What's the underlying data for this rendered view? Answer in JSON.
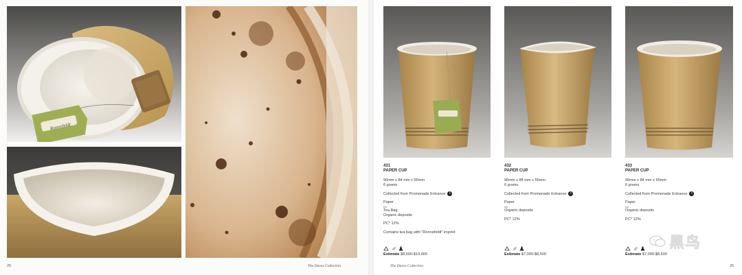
{
  "spread": {
    "left_folio": "25",
    "right_folio": "26",
    "collection_left": "The Davos Collection",
    "collection_right": "The Davos Collection"
  },
  "left_page": {
    "photos": [
      {
        "subject": "paper cup on its side with tea bag"
      },
      {
        "subject": "close-up of cup rim"
      },
      {
        "subject": "close-up of stained cup bottom"
      }
    ],
    "tag_text": "Ronnefeldt"
  },
  "lots": [
    {
      "number": "431",
      "title": "PAPER CUP",
      "dimensions": "90mm x 84 mm x 55mm",
      "weight": "6 grams",
      "collected": "Collected from Promenade Entrance",
      "info_marker": "i",
      "materials": [
        "Paper",
        "Tea Bag",
        "Organic deposits"
      ],
      "material_sub": "Ink",
      "pc": "PC* 12%",
      "note": "Contains tea bag with \"Ronnefeldt\" imprint",
      "estimate_label": "Estimate",
      "estimate_value": "$8,500-$10,000",
      "has_teabag": true
    },
    {
      "number": "432",
      "title": "PAPER CUP",
      "dimensions": "90mm x 84 mm x 55mm",
      "weight": "6 grams",
      "collected": "Collected from Promenade Entrance",
      "info_marker": "i",
      "materials": [
        "Paper",
        "Organic deposits"
      ],
      "material_sub": "Ink",
      "pc": "PC* 12%",
      "note": "",
      "estimate_label": "Estimate",
      "estimate_value": "$7,000-$8,500",
      "has_teabag": false
    },
    {
      "number": "433",
      "title": "PAPER CUP",
      "dimensions": "90mm x 84 mm x 55mm",
      "weight": "6 grams",
      "collected": "Collected from Promenade Entrance",
      "info_marker": "i",
      "materials": [
        "Paper",
        "Organic deposits"
      ],
      "material_sub": "Ink",
      "pc": "PC* 12%",
      "note": "",
      "estimate_label": "Estimate",
      "estimate_value": "$7,000-$8,500",
      "has_teabag": false
    }
  ],
  "watermark": {
    "text": "黑鸟"
  },
  "colors": {
    "cup_body": "#c9a66b",
    "cup_rim": "#f2eee4",
    "stain": "#6b3d1a",
    "backdrop": "#5c5c5c"
  }
}
